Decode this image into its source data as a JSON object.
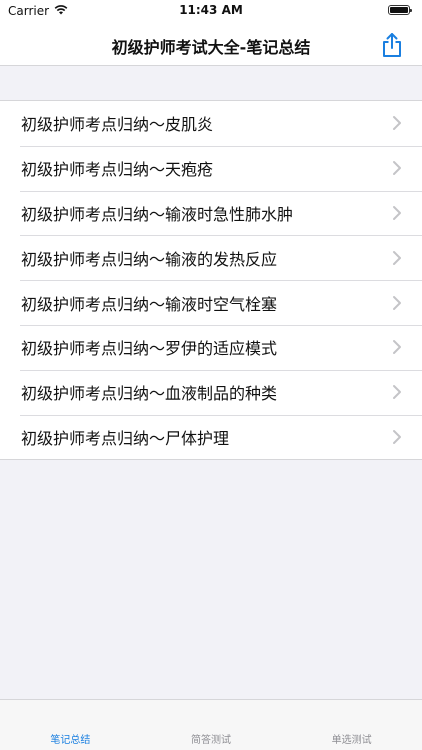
{
  "status_bar": {
    "carrier": "Carrier",
    "time": "11:43 AM"
  },
  "nav": {
    "title": "初级护师考试大全-笔记总结",
    "share_icon": "share-icon",
    "accent_color": "#1a7fe0"
  },
  "list": {
    "items": [
      {
        "label": "初级护师考点归纳～皮肌炎"
      },
      {
        "label": "初级护师考点归纳～天疱疮"
      },
      {
        "label": "初级护师考点归纳～输液时急性肺水肿"
      },
      {
        "label": "初级护师考点归纳～输液的发热反应"
      },
      {
        "label": "初级护师考点归纳～输液时空气栓塞"
      },
      {
        "label": "初级护师考点归纳～罗伊的适应模式"
      },
      {
        "label": "初级护师考点归纳～血液制品的种类"
      },
      {
        "label": "初级护师考点归纳～尸体护理"
      }
    ]
  },
  "tab_bar": {
    "tabs": [
      {
        "label": "笔记总结",
        "active": true
      },
      {
        "label": "简答测试",
        "active": false
      },
      {
        "label": "单选测试",
        "active": false
      }
    ]
  }
}
